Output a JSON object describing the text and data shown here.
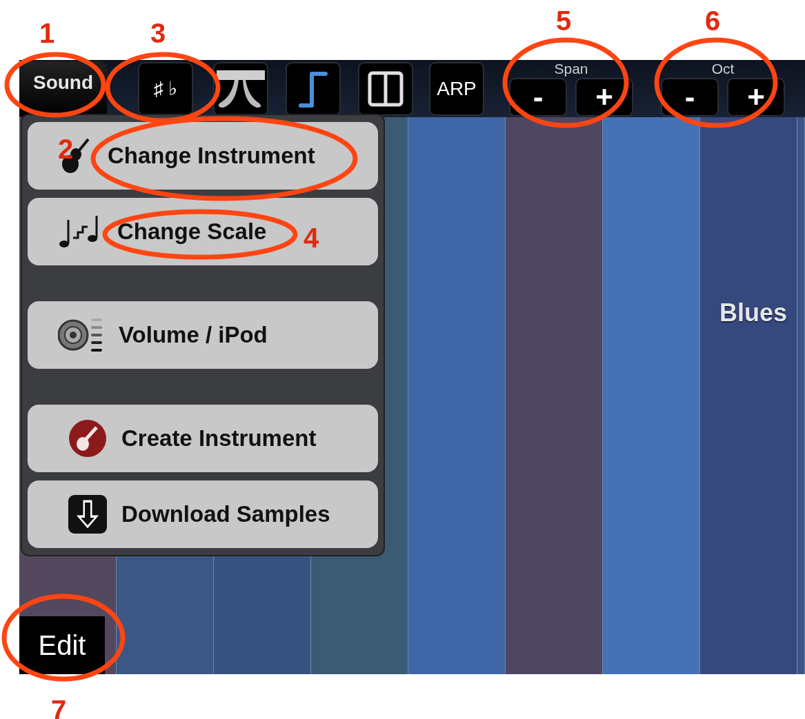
{
  "toolbar": {
    "sound_tab": "Sound",
    "buttons": [
      {
        "kind": "text",
        "label": "♯ ♭"
      },
      {
        "kind": "pedal"
      },
      {
        "kind": "step"
      },
      {
        "kind": "split"
      },
      {
        "kind": "text",
        "label": "ARP"
      }
    ],
    "steppers": [
      {
        "label": "Span",
        "minus": "-",
        "plus": "+"
      },
      {
        "label": "Oct",
        "minus": "-",
        "plus": "+"
      }
    ]
  },
  "menu": {
    "sections": [
      [
        {
          "label": "Change Instrument"
        },
        {
          "label": "Change Scale"
        }
      ],
      [
        {
          "label": "Volume / iPod"
        }
      ],
      [
        {
          "label": "Create Instrument"
        },
        {
          "label": "Download Samples"
        }
      ]
    ]
  },
  "keys": [
    {
      "color": "#54485f"
    },
    {
      "color": "#3c5784"
    },
    {
      "color": "#365380"
    },
    {
      "color": "#3b5b74"
    },
    {
      "color": "#3f66a6"
    },
    {
      "color": "#4f4662"
    },
    {
      "color": "#4472b4"
    },
    {
      "color": "#36497e"
    },
    {
      "color": "#3a5686"
    }
  ],
  "scale_label": "Blues",
  "edit_button": "Edit",
  "annotations": [
    {
      "label": "1"
    },
    {
      "label": "3"
    },
    {
      "label": "5"
    },
    {
      "label": "6"
    },
    {
      "label": "2"
    },
    {
      "label": "4"
    },
    {
      "label": "7"
    }
  ]
}
